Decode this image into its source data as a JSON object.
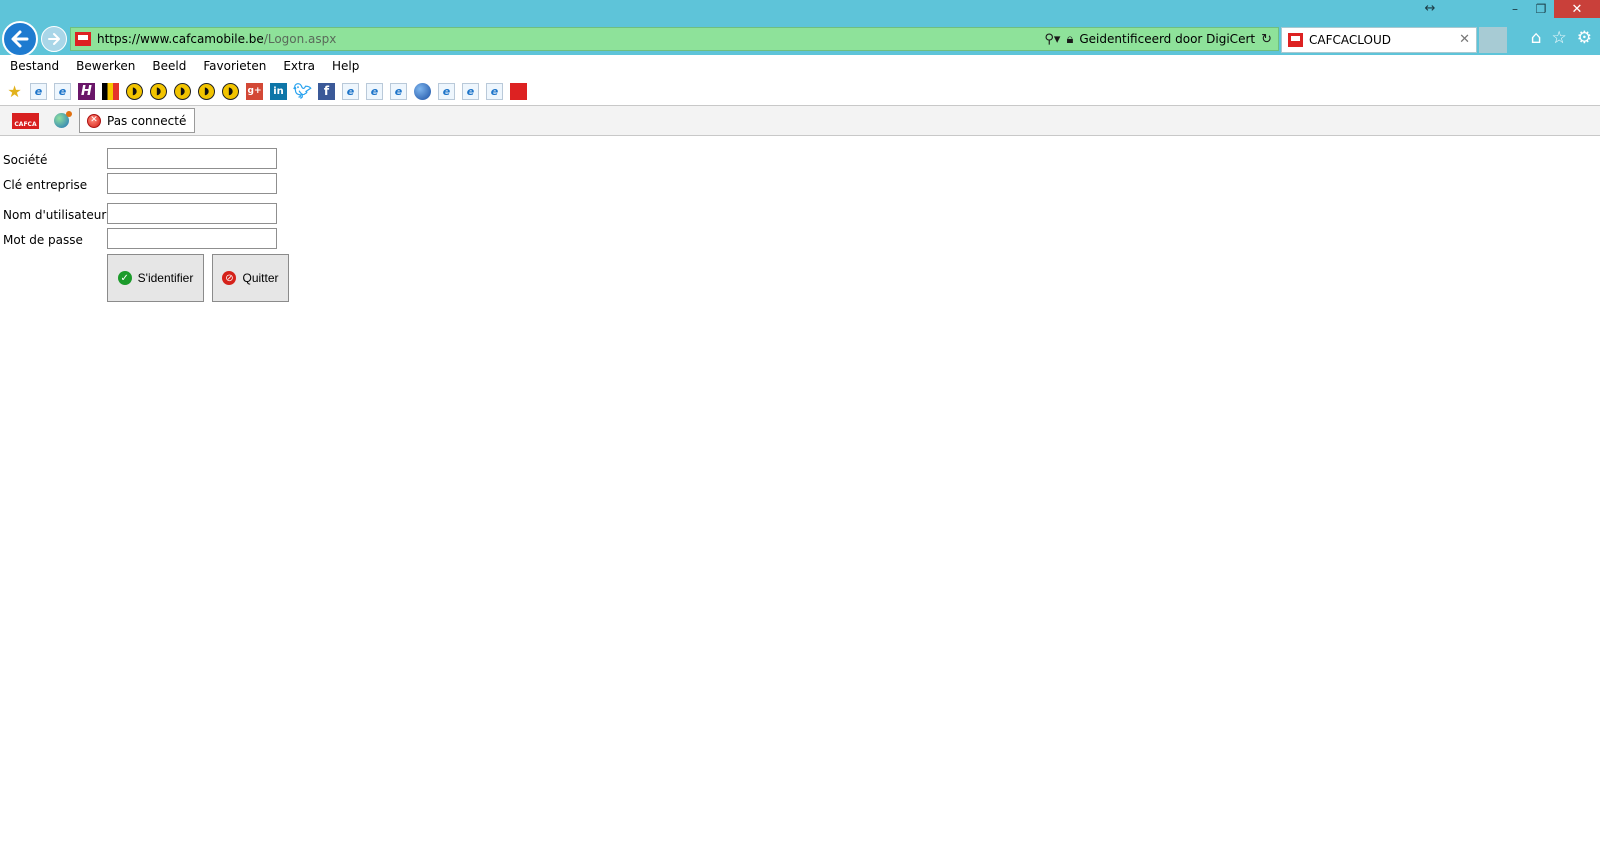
{
  "browser": {
    "url_host": "https://www.cafcamobile.be",
    "url_path": "/Logon.aspx",
    "identity": "Geidentificeerd door DigiCert",
    "tab_title": "CAFCACLOUD",
    "colors": {
      "frame": "#5ec4d9",
      "address_secure": "#8ee29a",
      "close": "#c9403a"
    }
  },
  "menu": [
    "Bestand",
    "Bewerken",
    "Beeld",
    "Favorieten",
    "Extra",
    "Help"
  ],
  "app_toolbar": {
    "connection_status": "Pas connecté"
  },
  "login": {
    "company_label": "Société",
    "company_value": "",
    "key_label": "Clé entreprise",
    "key_value": "",
    "username_label": "Nom d'utilisateur",
    "username_value": "",
    "password_label": "Mot de passe",
    "password_value": "",
    "submit_label": "S'identifier",
    "quit_label": "Quitter"
  },
  "favorites_icons": [
    "favorites-star-icon",
    "ie-page-icon",
    "ie-page-icon",
    "h-icon",
    "belgian-flag-icon",
    "yellow-circle-icon",
    "yellow-circle-icon",
    "yellow-circle-icon",
    "yellow-circle-icon",
    "yellow-circle-icon",
    "google-plus-icon",
    "linkedin-icon",
    "twitter-icon",
    "facebook-icon",
    "ie-page-icon",
    "ie-page-icon",
    "ie-page-icon",
    "globe-icon",
    "ie-page-icon",
    "ie-page-icon",
    "ie-page-icon",
    "cafca-icon"
  ]
}
